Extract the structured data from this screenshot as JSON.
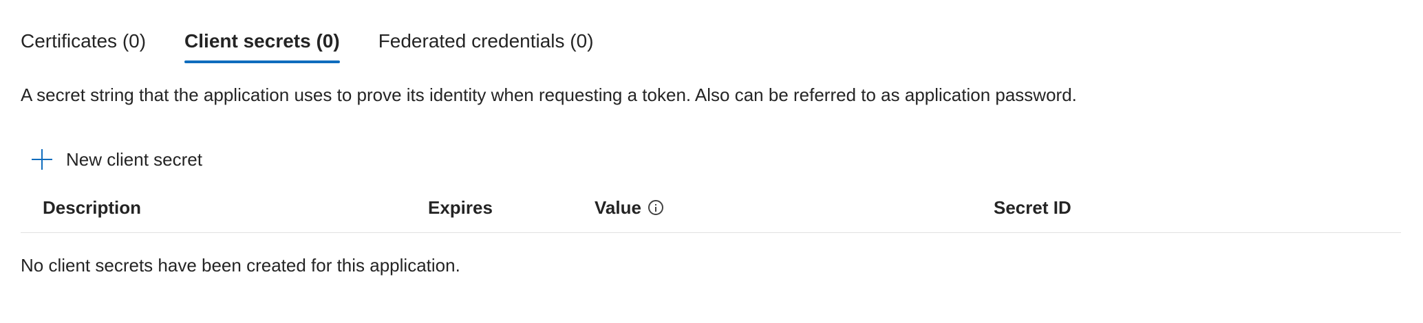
{
  "tabs": [
    {
      "label": "Certificates (0)",
      "active": false
    },
    {
      "label": "Client secrets (0)",
      "active": true
    },
    {
      "label": "Federated credentials (0)",
      "active": false
    }
  ],
  "description": "A secret string that the application uses to prove its identity when requesting a token. Also can be referred to as application password.",
  "toolbar": {
    "new_secret_label": "New client secret",
    "new_secret_icon": "plus-icon"
  },
  "table": {
    "columns": [
      "Description",
      "Expires",
      "Value",
      "Secret ID"
    ],
    "value_info_icon": "info-icon",
    "rows": [],
    "empty_message": "No client secrets have been created for this application."
  },
  "colors": {
    "accent": "#0f6cbd",
    "text": "#242424",
    "divider": "#e0e0e0"
  }
}
